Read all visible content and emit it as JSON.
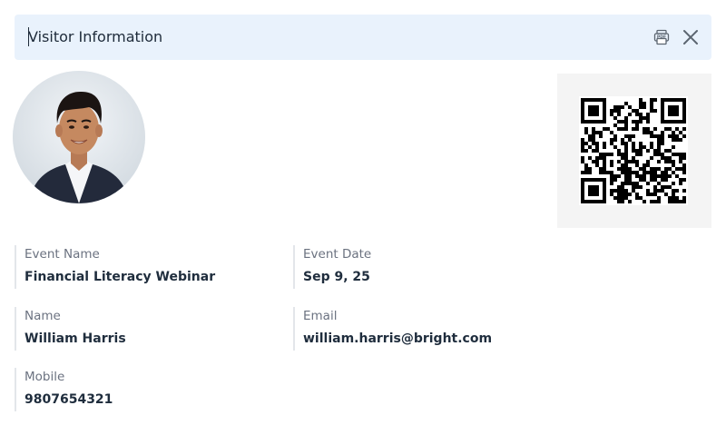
{
  "dialog": {
    "title": "Visitor Information",
    "pdf_icon": "pdf-download-icon",
    "close_icon": "close-icon"
  },
  "visitor": {
    "photo": "avatar-photo",
    "qr_icon": "qr-code",
    "fields": [
      {
        "label": "Event Name",
        "value": "Financial Literacy Webinar"
      },
      {
        "label": "Event Date",
        "value": "Sep 9, 25"
      },
      {
        "label": "Name",
        "value": "William Harris"
      },
      {
        "label": "Email",
        "value": "william.harris@bright.com"
      },
      {
        "label": "Mobile",
        "value": "9807654321"
      }
    ]
  },
  "colors": {
    "header_bg": "#e9f2fc",
    "text_dark": "#1f2d3d",
    "label_gray": "#6b7280",
    "divider": "#e3e6ea",
    "qr_panel_bg": "#f4f4f4"
  }
}
